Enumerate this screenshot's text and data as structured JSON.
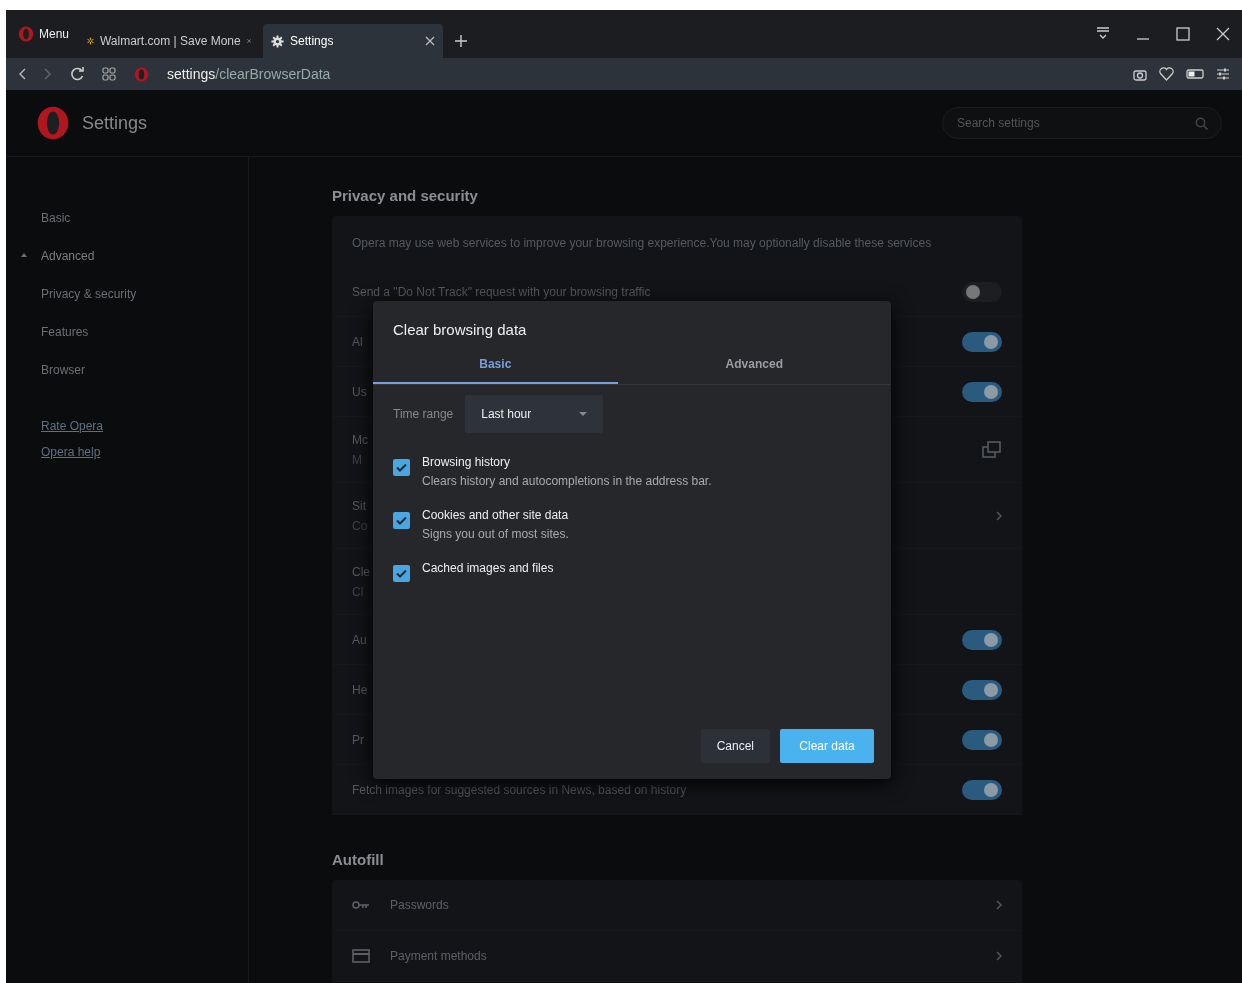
{
  "browser": {
    "menu_label": "Menu",
    "tabs": [
      {
        "title": "Walmart.com | Save Mone",
        "kind": "walmart",
        "selected": false
      },
      {
        "title": "Settings",
        "kind": "gear",
        "selected": true
      }
    ],
    "address": {
      "host": "settings",
      "path": "/clearBrowserData"
    }
  },
  "header": {
    "title": "Settings",
    "search": {
      "placeholder": "Search settings"
    }
  },
  "sidebar": {
    "items": [
      {
        "label": "Basic",
        "expanded": false
      },
      {
        "label": "Advanced",
        "expanded": true,
        "children": [
          {
            "label": "Privacy & security"
          },
          {
            "label": "Features"
          },
          {
            "label": "Browser"
          }
        ]
      }
    ],
    "links": [
      "Rate Opera",
      "Opera help"
    ]
  },
  "privacy": {
    "heading": "Privacy and security",
    "intro": "Opera may use web services to improve your browsing experience.You may optionally disable these services",
    "rows": [
      {
        "title": "Send a \"Do Not Track\" request with your browsing traffic",
        "kind": "toggle",
        "on": false
      },
      {
        "title": "Al",
        "kind": "toggle",
        "on": true
      },
      {
        "title": "Us",
        "kind": "toggle",
        "on": true
      },
      {
        "title": "Mc",
        "subtitle": "M",
        "kind": "external"
      },
      {
        "title": "Sit",
        "subtitle": "Co",
        "kind": "chevron"
      },
      {
        "title": "Cle",
        "subtitle": "Cl",
        "kind": "none"
      },
      {
        "title": "Au",
        "kind": "toggle",
        "on": true
      },
      {
        "title": "He",
        "kind": "toggle",
        "on": true
      },
      {
        "title": "Pr",
        "kind": "toggle",
        "on": true
      },
      {
        "title": "Fetch images for suggested sources in News, based on history",
        "kind": "toggle",
        "on": true
      }
    ]
  },
  "autofill": {
    "heading": "Autofill",
    "rows": [
      {
        "label": "Passwords",
        "kind": "key"
      },
      {
        "label": "Payment methods",
        "kind": "card"
      }
    ]
  },
  "dialog": {
    "title": "Clear browsing data",
    "tabs": [
      {
        "label": "Basic",
        "selected": true
      },
      {
        "label": "Advanced",
        "selected": false
      }
    ],
    "time_range": {
      "label": "Time range",
      "value": "Last hour"
    },
    "options": [
      {
        "title": "Browsing history",
        "subtitle": "Clears history and autocompletions in the address bar.",
        "checked": true
      },
      {
        "title": "Cookies and other site data",
        "subtitle": "Signs you out of most sites.",
        "checked": true
      },
      {
        "title": "Cached images and files",
        "checked": true
      }
    ],
    "buttons": [
      {
        "label": "Cancel",
        "kind": "secondary"
      },
      {
        "label": "Clear data",
        "kind": "primary"
      }
    ]
  }
}
